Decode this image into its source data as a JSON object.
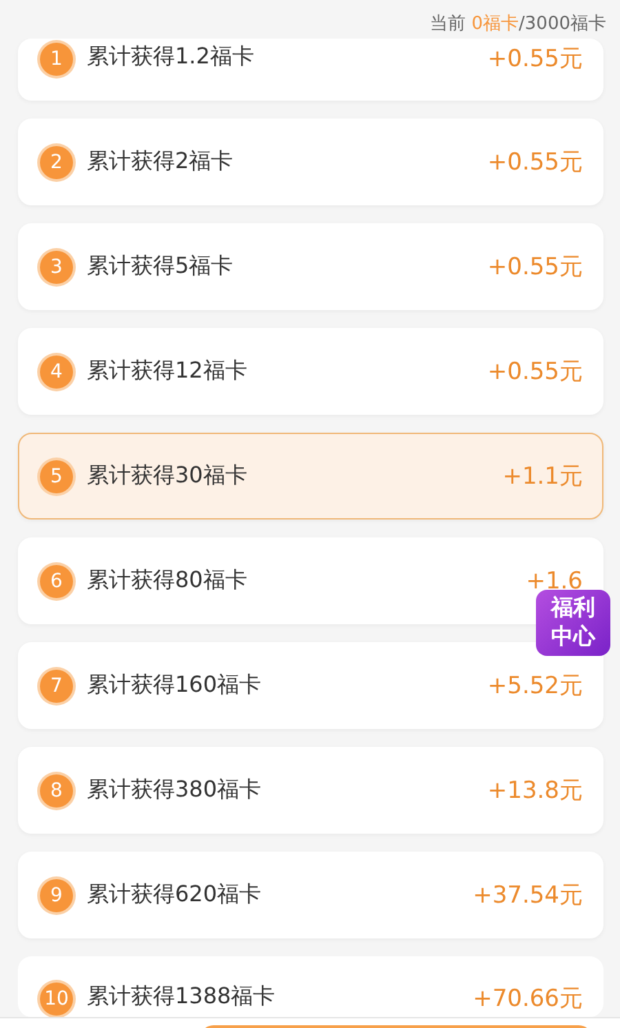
{
  "progress": {
    "prefix": "当前 ",
    "current": "0福卡",
    "total": "/3000福卡"
  },
  "tiers": [
    {
      "index": "1",
      "label": "累计获得1.2福卡",
      "reward": "+0.55元",
      "selected": false
    },
    {
      "index": "2",
      "label": "累计获得2福卡",
      "reward": "+0.55元",
      "selected": false
    },
    {
      "index": "3",
      "label": "累计获得5福卡",
      "reward": "+0.55元",
      "selected": false
    },
    {
      "index": "4",
      "label": "累计获得12福卡",
      "reward": "+0.55元",
      "selected": false
    },
    {
      "index": "5",
      "label": "累计获得30福卡",
      "reward": "+1.1元",
      "selected": true
    },
    {
      "index": "6",
      "label": "累计获得80福卡",
      "reward": "+1.6",
      "selected": false
    },
    {
      "index": "7",
      "label": "累计获得160福卡",
      "reward": "+5.52元",
      "selected": false
    },
    {
      "index": "8",
      "label": "累计获得380福卡",
      "reward": "+13.8元",
      "selected": false
    },
    {
      "index": "9",
      "label": "累计获得620福卡",
      "reward": "+37.54元",
      "selected": false
    },
    {
      "index": "10",
      "label": "累计获得1388福卡",
      "reward": "+70.66元",
      "selected": false
    }
  ],
  "floating_badge": {
    "label": "福利中心"
  }
}
